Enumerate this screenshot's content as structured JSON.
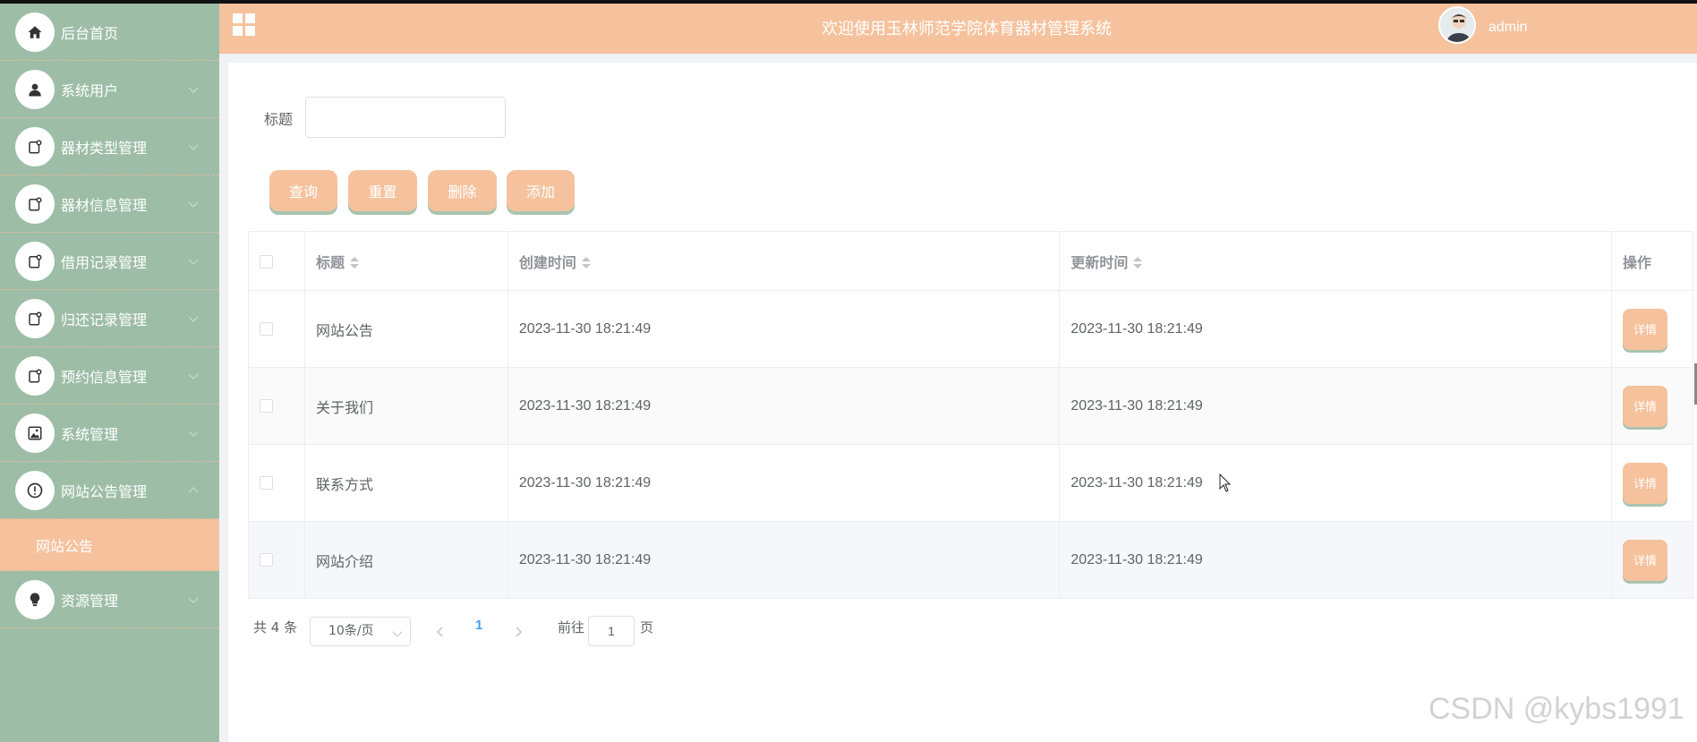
{
  "header": {
    "title": "欢迎使用玉林师范学院体育器材管理系统",
    "username": "admin"
  },
  "sidebar": {
    "items": [
      {
        "label": "后台首页",
        "icon": "home-icon"
      },
      {
        "label": "系统用户",
        "icon": "user-icon"
      },
      {
        "label": "器材类型管理",
        "icon": "document-icon"
      },
      {
        "label": "器材信息管理",
        "icon": "document-icon"
      },
      {
        "label": "借用记录管理",
        "icon": "document-icon"
      },
      {
        "label": "归还记录管理",
        "icon": "document-icon"
      },
      {
        "label": "预约信息管理",
        "icon": "document-icon"
      },
      {
        "label": "系统管理",
        "icon": "picture-icon"
      },
      {
        "label": "网站公告管理",
        "icon": "info-icon"
      },
      {
        "label": "资源管理",
        "icon": "bulb-icon"
      }
    ],
    "active_sub": "网站公告"
  },
  "search": {
    "label": "标题",
    "value": ""
  },
  "buttons": {
    "query": "查询",
    "reset": "重置",
    "delete": "删除",
    "add": "添加"
  },
  "table": {
    "headers": {
      "title": "标题",
      "created": "创建时间",
      "updated": "更新时间",
      "action": "操作"
    },
    "detail_label": "详情",
    "rows": [
      {
        "title": "网站公告",
        "created": "2023-11-30 18:21:49",
        "updated": "2023-11-30 18:21:49"
      },
      {
        "title": "关于我们",
        "created": "2023-11-30 18:21:49",
        "updated": "2023-11-30 18:21:49"
      },
      {
        "title": "联系方式",
        "created": "2023-11-30 18:21:49",
        "updated": "2023-11-30 18:21:49"
      },
      {
        "title": "网站介绍",
        "created": "2023-11-30 18:21:49",
        "updated": "2023-11-30 18:21:49"
      }
    ]
  },
  "pagination": {
    "total": "共 4 条",
    "page_size": "10条/页",
    "current_page": "1",
    "goto_label": "前往",
    "goto_value": "1",
    "page_suffix": "页"
  },
  "watermark": "CSDN @kybs1991",
  "colors": {
    "sidebar": "#9dbda7",
    "accent": "#f5c29d",
    "page_active": "#409eff"
  }
}
